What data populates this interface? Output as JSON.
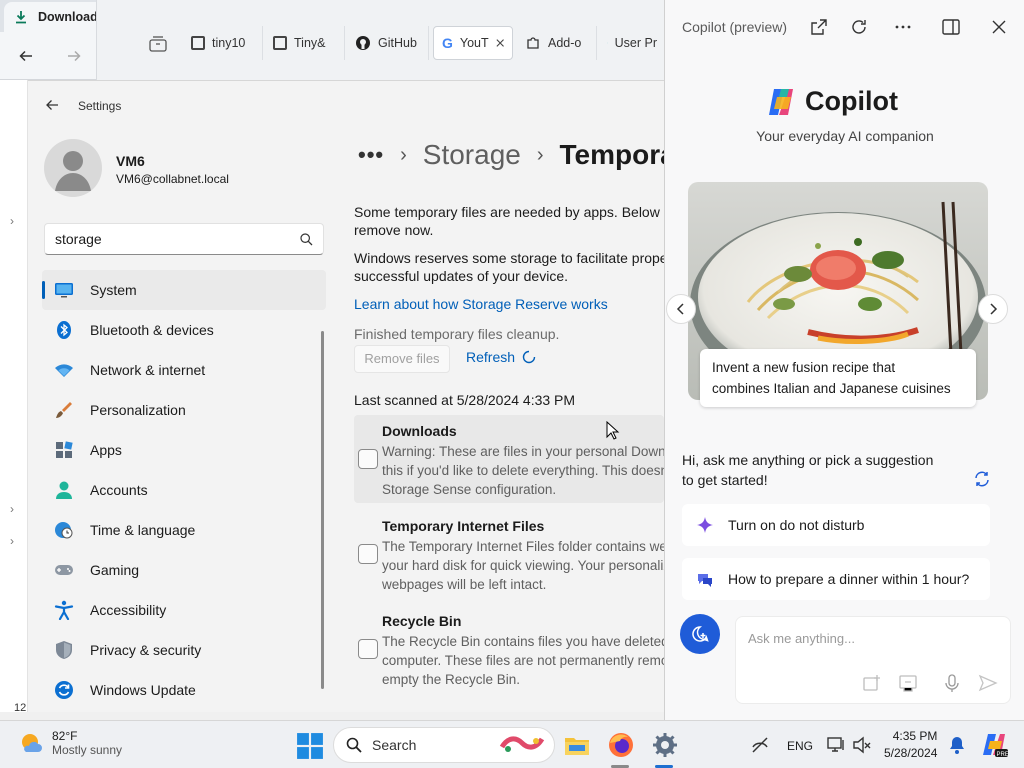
{
  "browser": {
    "tab_title": "Downloads",
    "new_tab": "+",
    "tabs": [
      {
        "label": "tiny10"
      },
      {
        "label": "Tiny&"
      },
      {
        "label": "GitHub"
      },
      {
        "label": "YouT"
      },
      {
        "label": "Add-o"
      },
      {
        "label": "User Pr"
      }
    ],
    "behind_text": "12"
  },
  "settings": {
    "window_title": "Settings",
    "user": {
      "name": "VM6",
      "email": "VM6@collabnet.local"
    },
    "search": {
      "value": "storage"
    },
    "nav": [
      {
        "label": "System",
        "icon": "system-icon"
      },
      {
        "label": "Bluetooth & devices",
        "icon": "bluetooth-icon"
      },
      {
        "label": "Network & internet",
        "icon": "network-icon"
      },
      {
        "label": "Personalization",
        "icon": "brush-icon"
      },
      {
        "label": "Apps",
        "icon": "apps-icon"
      },
      {
        "label": "Accounts",
        "icon": "accounts-icon"
      },
      {
        "label": "Time & language",
        "icon": "globe-clock-icon"
      },
      {
        "label": "Gaming",
        "icon": "gamepad-icon"
      },
      {
        "label": "Accessibility",
        "icon": "accessibility-icon"
      },
      {
        "label": "Privacy & security",
        "icon": "shield-icon"
      },
      {
        "label": "Windows Update",
        "icon": "update-icon"
      }
    ],
    "breadcrumb": {
      "dots": "•••",
      "sep": "›",
      "parent": "Storage",
      "current": "Temporary files"
    },
    "intro": [
      "Some temporary files are needed by apps. Below is a list of files you can",
      "remove now."
    ],
    "reserve": [
      "Windows reserves some storage to facilitate proper functioning and",
      "successful updates of your device."
    ],
    "learn_link": "Learn about how Storage Reserve works",
    "status": "Finished temporary files cleanup.",
    "remove_button": "Remove files",
    "refresh": "Refresh",
    "last_scanned": "Last scanned at 5/28/2024 4:33 PM",
    "categories": [
      {
        "title": "Downloads",
        "desc": [
          "Warning: These are files in your personal Downloads folder. Select",
          "this if you'd like to delete everything. This doesn't respect your",
          "Storage Sense configuration."
        ]
      },
      {
        "title": "Temporary Internet Files",
        "desc": [
          "The Temporary Internet Files folder contains webpages stored on",
          "your hard disk for quick viewing. Your personalized settings for",
          "webpages will be left intact."
        ]
      },
      {
        "title": "Recycle Bin",
        "desc": [
          "The Recycle Bin contains files you have deleted from your",
          "computer. These files are not permanently removed until you",
          "empty the Recycle Bin."
        ]
      }
    ]
  },
  "copilot": {
    "header": "Copilot (preview)",
    "name": "Copilot",
    "tagline": "Your everyday AI companion",
    "card_caption": [
      "Invent a new fusion recipe that",
      "combines Italian and Japanese cuisines"
    ],
    "greeting": [
      "Hi, ask me anything or pick a suggestion",
      "to get started!"
    ],
    "suggestions": [
      {
        "label": "Turn on do not disturb",
        "icon": "sparkle-icon"
      },
      {
        "label": "How to prepare a dinner within 1 hour?",
        "icon": "chat-bubbles-icon"
      }
    ],
    "ask_placeholder": "Ask me anything..."
  },
  "taskbar": {
    "weather": {
      "temp": "82°F",
      "condition": "Mostly sunny"
    },
    "search_label": "Search",
    "language": "ENG",
    "time": "4:35 PM",
    "date": "5/28/2024"
  },
  "colors": {
    "accent": "#005fb8",
    "copilot_blue": "#1f5cd8",
    "settings_bg": "#f3f3f3"
  }
}
